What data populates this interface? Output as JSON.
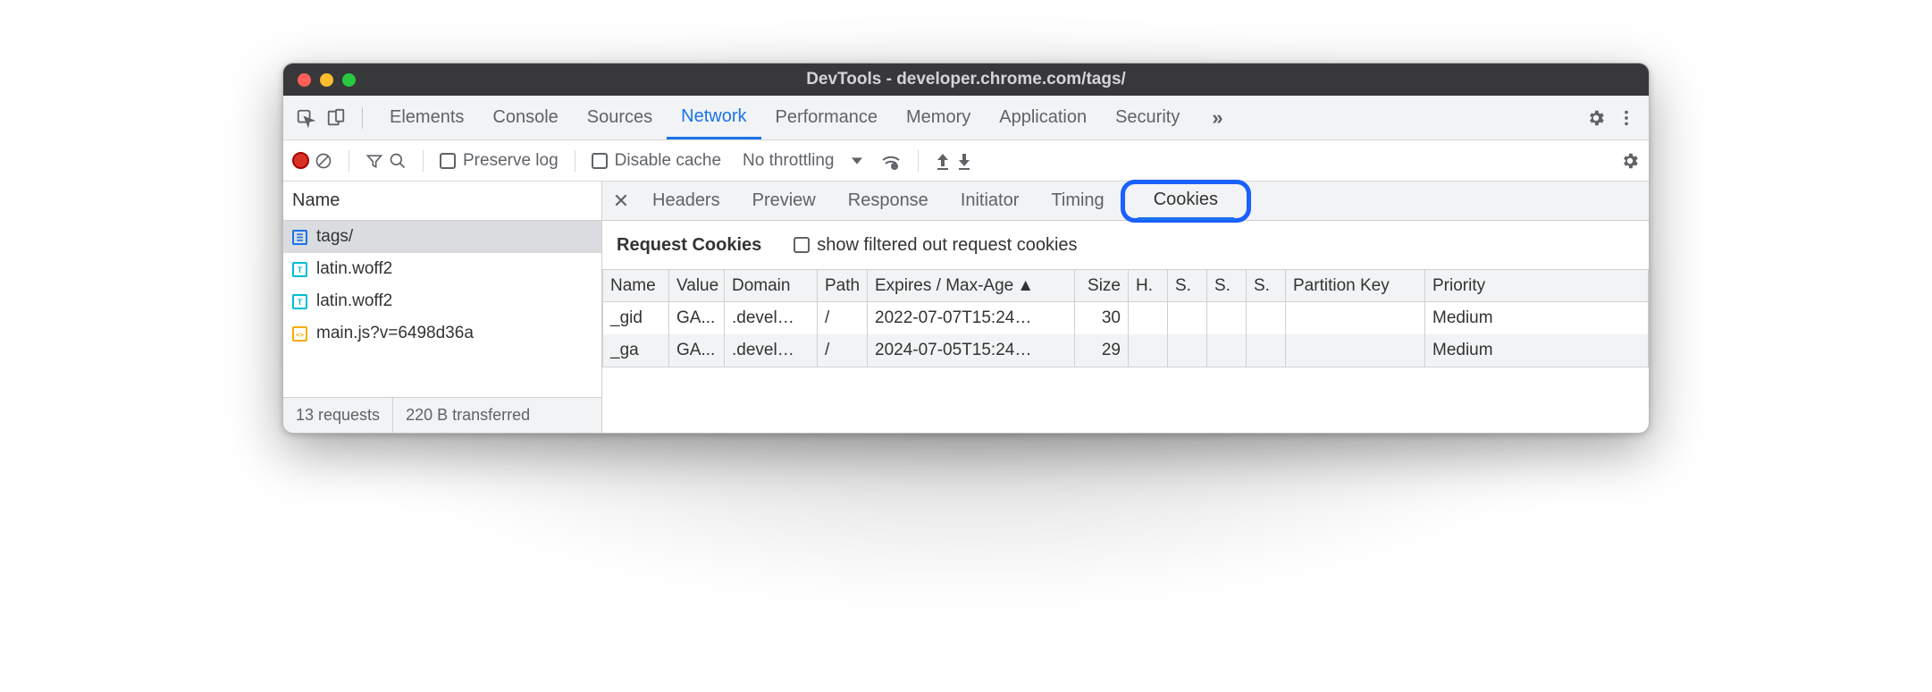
{
  "title": "DevTools - developer.chrome.com/tags/",
  "top_tabs": [
    "Elements",
    "Console",
    "Sources",
    "Network",
    "Performance",
    "Memory",
    "Application",
    "Security"
  ],
  "top_active": "Network",
  "net_toolbar": {
    "preserve_log": "Preserve log",
    "disable_cache": "Disable cache",
    "throttling": "No throttling"
  },
  "name_header": "Name",
  "requests": [
    {
      "icon": "doc",
      "label": "tags/",
      "selected": true
    },
    {
      "icon": "fnt",
      "label": "latin.woff2",
      "selected": false
    },
    {
      "icon": "fnt",
      "label": "latin.woff2",
      "selected": false
    },
    {
      "icon": "js",
      "label": "main.js?v=6498d36a",
      "selected": false
    }
  ],
  "footer": {
    "requests": "13 requests",
    "transferred": "220 B transferred"
  },
  "detail_tabs": [
    "Headers",
    "Preview",
    "Response",
    "Initiator",
    "Timing",
    "Cookies"
  ],
  "detail_active": "Cookies",
  "cookies": {
    "title": "Request Cookies",
    "filter_label": "show filtered out request cookies",
    "columns": [
      "Name",
      "Value",
      "Domain",
      "Path",
      "Expires / Max-Age",
      "Size",
      "H.",
      "S.",
      "S.",
      "S.",
      "Partition Key",
      "Priority"
    ],
    "sort_col": "Expires / Max-Age",
    "rows": [
      {
        "name": "_gid",
        "value": "GA...",
        "domain": ".devel…",
        "path": "/",
        "expires": "2022-07-07T15:24…",
        "size": "30",
        "h": "",
        "s1": "",
        "s2": "",
        "s3": "",
        "pk": "",
        "priority": "Medium"
      },
      {
        "name": "_ga",
        "value": "GA...",
        "domain": ".devel…",
        "path": "/",
        "expires": "2024-07-05T15:24…",
        "size": "29",
        "h": "",
        "s1": "",
        "s2": "",
        "s3": "",
        "pk": "",
        "priority": "Medium"
      }
    ]
  }
}
